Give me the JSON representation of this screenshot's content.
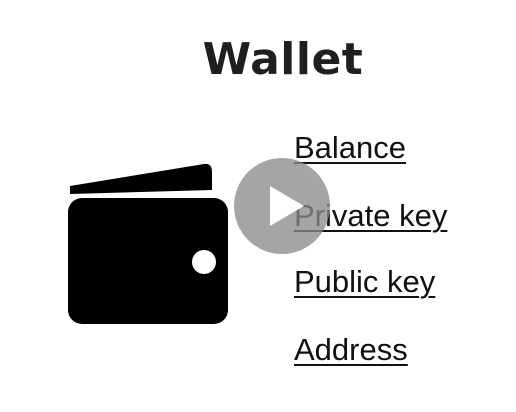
{
  "page": {
    "title": "Wallet"
  },
  "links": [
    {
      "label": "Balance"
    },
    {
      "label": "Private key"
    },
    {
      "label": "Public key"
    },
    {
      "label": "Address"
    }
  ],
  "icons": {
    "wallet": "wallet-icon",
    "play": "play-icon"
  },
  "colors": {
    "text": "#111111",
    "play_overlay": "#8c8c8c"
  }
}
